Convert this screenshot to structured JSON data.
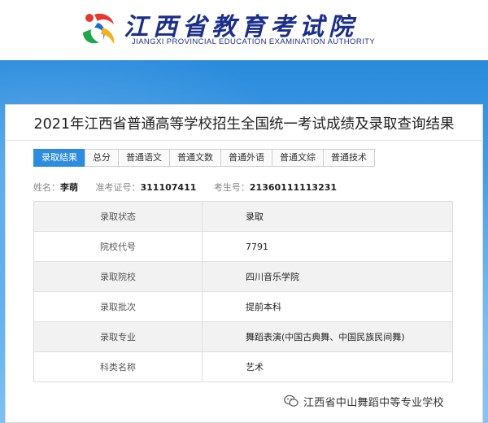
{
  "header": {
    "title": "江西省教育考试院",
    "subtitle": "JIANGXI PROVINCIAL EDUCATION EXAMINATION AUTHORITY",
    "logo_icon": "jx-logo-icon",
    "brand_color": "#1c2f8a"
  },
  "page": {
    "title": "2021年江西省普通高等学校招生全国统一考试成绩及录取查询结果",
    "band_color": "#2a8bdc"
  },
  "tabs": [
    {
      "label": "录取结果",
      "active": true
    },
    {
      "label": "总分",
      "active": false
    },
    {
      "label": "普通语文",
      "active": false
    },
    {
      "label": "普通文数",
      "active": false
    },
    {
      "label": "普通外语",
      "active": false
    },
    {
      "label": "普通文综",
      "active": false
    },
    {
      "label": "普通技术",
      "active": false
    }
  ],
  "student": {
    "name_label": "姓名：",
    "name": "李萌",
    "ticket_label": "准考证号：",
    "ticket": "311107411",
    "exam_no_label": "考生号：",
    "exam_no": "21360111113231"
  },
  "result_rows": [
    {
      "key": "录取状态",
      "value": "录取"
    },
    {
      "key": "院校代号",
      "value": "7791"
    },
    {
      "key": "录取院校",
      "value": "四川音乐学院"
    },
    {
      "key": "录取批次",
      "value": "提前本科"
    },
    {
      "key": "录取专业",
      "value": "舞蹈表演(中国古典舞、中国民族民间舞)"
    },
    {
      "key": "科类名称",
      "value": "艺术"
    }
  ],
  "watermark": {
    "icon": "wechat-icon",
    "text": "江西省中山舞蹈中等专业学校"
  }
}
